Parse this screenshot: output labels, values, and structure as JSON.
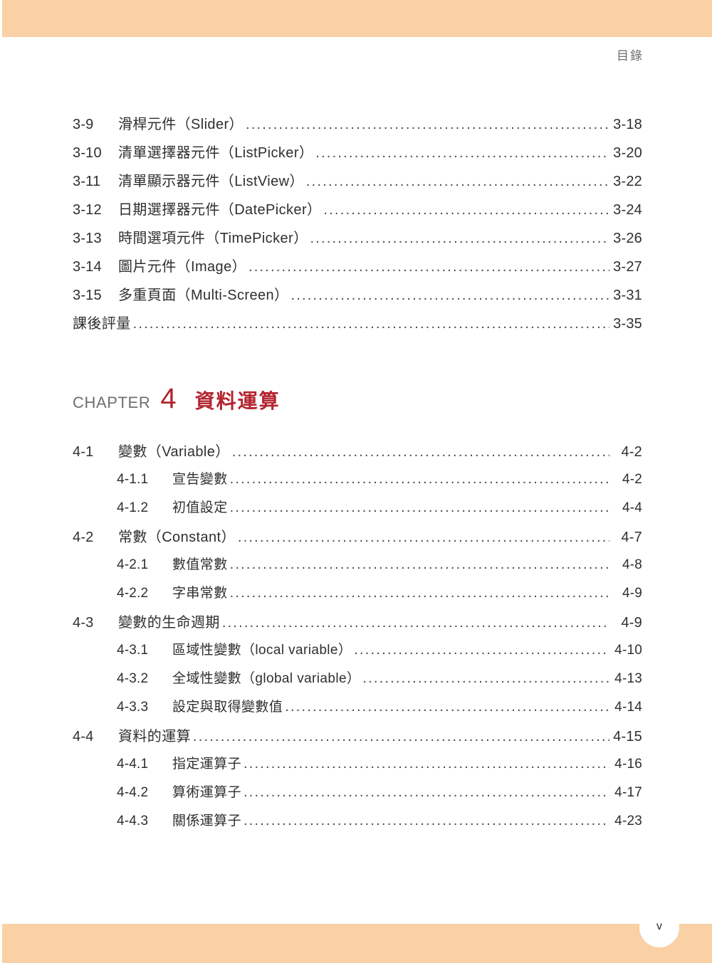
{
  "page": {
    "running_header": "目錄",
    "folio": "v",
    "band_color": "#fad0a5",
    "accent_color": "#b3242f"
  },
  "toc": {
    "chapter3_entries": [
      {
        "num": "3-9",
        "title": "滑桿元件（Slider）",
        "page": "3-18",
        "level": 1
      },
      {
        "num": "3-10",
        "title": "清單選擇器元件（ListPicker）",
        "page": "3-20",
        "level": 1
      },
      {
        "num": "3-11",
        "title": "清單顯示器元件（ListView）",
        "page": "3-22",
        "level": 1
      },
      {
        "num": "3-12",
        "title": "日期選擇器元件（DatePicker）",
        "page": "3-24",
        "level": 1
      },
      {
        "num": "3-13",
        "title": "時間選項元件（TimePicker）",
        "page": "3-26",
        "level": 1
      },
      {
        "num": "3-14",
        "title": "圖片元件（Image）",
        "page": "3-27",
        "level": 1
      },
      {
        "num": "3-15",
        "title": "多重頁面（Multi-Screen）",
        "page": "3-31",
        "level": 1
      },
      {
        "num": "",
        "title": "課後評量",
        "page": "3-35",
        "level": 1
      }
    ],
    "chapter4_heading": {
      "word": "CHAPTER",
      "number": "4",
      "title": "資料運算"
    },
    "chapter4_entries": [
      {
        "num": "4-1",
        "title": "變數（Variable）",
        "page": "4-2",
        "level": 1
      },
      {
        "num": "4-1.1",
        "title": "宣告變數",
        "page": "4-2",
        "level": 2
      },
      {
        "num": "4-1.2",
        "title": "初值設定",
        "page": "4-4",
        "level": 2
      },
      {
        "num": "4-2",
        "title": "常數（Constant）",
        "page": "4-7",
        "level": 1
      },
      {
        "num": "4-2.1",
        "title": "數值常數",
        "page": "4-8",
        "level": 2
      },
      {
        "num": "4-2.2",
        "title": "字串常數",
        "page": "4-9",
        "level": 2
      },
      {
        "num": "4-3",
        "title": "變數的生命週期",
        "page": "4-9",
        "level": 1
      },
      {
        "num": "4-3.1",
        "title": "區域性變數（local variable）",
        "page": "4-10",
        "level": 2
      },
      {
        "num": "4-3.2",
        "title": "全域性變數（global variable）",
        "page": "4-13",
        "level": 2
      },
      {
        "num": "4-3.3",
        "title": "設定與取得變數值",
        "page": "4-14",
        "level": 2
      },
      {
        "num": "4-4",
        "title": "資料的運算",
        "page": "4-15",
        "level": 1
      },
      {
        "num": "4-4.1",
        "title": "指定運算子",
        "page": "4-16",
        "level": 2
      },
      {
        "num": "4-4.2",
        "title": "算術運算子",
        "page": "4-17",
        "level": 2
      },
      {
        "num": "4-4.3",
        "title": "關係運算子",
        "page": "4-23",
        "level": 2
      }
    ]
  }
}
